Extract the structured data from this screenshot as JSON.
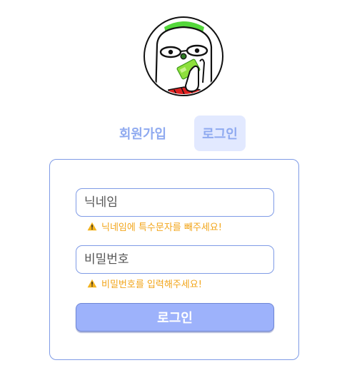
{
  "avatar": {
    "icon": "cartoon-character-avatar"
  },
  "tabs": [
    {
      "label": "회원가입",
      "active": false
    },
    {
      "label": "로그인",
      "active": true
    }
  ],
  "form": {
    "nickname_placeholder": "닉네임",
    "nickname_error": "닉네임에 특수문자를 빼주세요!",
    "password_placeholder": "비밀번호",
    "password_error": "비밀번호를 입력해주세요!",
    "submit_label": "로그인",
    "warning_icon": "warning-triangle"
  },
  "colors": {
    "accent": "#8faaf0",
    "border": "#7f9be6",
    "button": "#9db2fb",
    "active_tab_bg": "#e2e9ff",
    "warning": "#f2a51a"
  }
}
